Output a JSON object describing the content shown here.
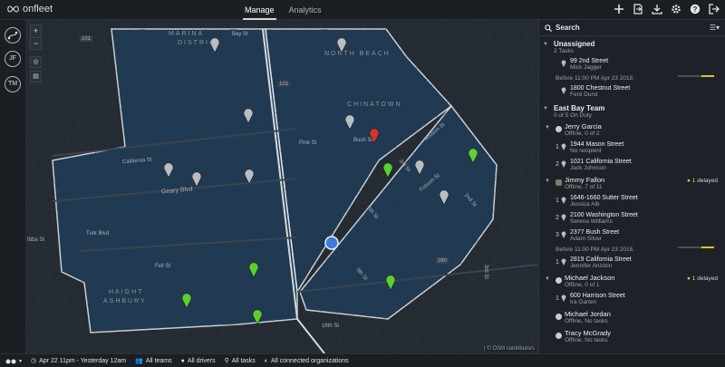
{
  "brand": {
    "name": "onfleet"
  },
  "nav": {
    "tabs": [
      {
        "label": "Manage",
        "active": true
      },
      {
        "label": "Analytics",
        "active": false
      }
    ]
  },
  "toolbar": {
    "icons": [
      "plus-icon",
      "import-icon",
      "download-icon",
      "gear-icon",
      "help-icon",
      "logout-icon"
    ]
  },
  "rail": {
    "items": [
      "JF",
      "TM"
    ]
  },
  "map": {
    "attribution": "| © OSM contributors",
    "neighborhoods": [
      "MARINA",
      "DISTRICT",
      "NORTH BEACH",
      "CHINATOWN",
      "HAIGHT",
      "ASHBURY"
    ],
    "streets": [
      "Bay St",
      "California St",
      "Geary Blvd",
      "Turk Blvd",
      "Fell St",
      "Pine St",
      "Bush St",
      "3rd St",
      "Folsom St",
      "6th St",
      "9th St",
      "2nd St",
      "16th St",
      "Mission St",
      "3rd St",
      "Ibba St"
    ],
    "shields": [
      "101",
      "101",
      "280"
    ]
  },
  "sidebar": {
    "search_label": "Search",
    "unassigned": {
      "title": "Unassigned",
      "subtitle": "2 Tasks",
      "tasks": [
        {
          "address": "99 2nd Street",
          "contact": "Mick Jagger"
        },
        {
          "address": "1800 Chestnut Street",
          "contact": "Ferd Durst"
        }
      ],
      "before": "Before 11:00 PM Apr 23 2018."
    },
    "team": {
      "title": "East Bay Team",
      "subtitle": "0 of 5 On Duty"
    },
    "workers": [
      {
        "name": "Jerry Garcia",
        "status": "Offline, 0 of 2",
        "delayed": "",
        "tasks": [
          {
            "n": "1",
            "address": "1944 Mason Street",
            "contact": "No recipient"
          },
          {
            "n": "2",
            "address": "1021 California Street",
            "contact": "Jack Johnson"
          }
        ]
      },
      {
        "name": "Jimmy Fallon",
        "status": "Offline, 7 of 11",
        "delayed": "1 delayed",
        "tasks": [
          {
            "n": "1",
            "address": "1646-1660 Sutter Street",
            "contact": "Jessica Alb"
          },
          {
            "n": "2",
            "address": "2100 Washington Street",
            "contact": "Serena Williams"
          },
          {
            "n": "3",
            "address": "2377 Bush Street",
            "contact": "Adam Silver"
          }
        ],
        "before": "Before 11:00 PM Apr 23 2018.",
        "tasks2": [
          {
            "n": "1",
            "address": "2819 California Street",
            "contact": "Jennifer Aniston"
          }
        ]
      },
      {
        "name": "Michael Jackson",
        "status": "Offline, 0 of 1",
        "delayed": "1 delayed",
        "tasks": [
          {
            "n": "1",
            "address": "600 Harrison Street",
            "contact": "Ira Garten"
          }
        ]
      },
      {
        "name": "Michael Jordan",
        "status": "Offline, No tasks",
        "delayed": "",
        "tasks": []
      },
      {
        "name": "Tracy McGrady",
        "status": "Offline, No tasks",
        "delayed": "",
        "tasks": []
      }
    ]
  },
  "filters": {
    "date": "Apr 22 11pm - Yesterday 12am",
    "teams": "All teams",
    "drivers": "All drivers",
    "tasks": "All tasks",
    "orgs": "All connected organizations"
  },
  "colors": {
    "accent_yellow": "#d8c22d",
    "pin_green": "#5bd12f",
    "pin_red": "#d6342b",
    "pin_gray": "#b8bdc2",
    "driver_blue": "#3b7ed9"
  }
}
